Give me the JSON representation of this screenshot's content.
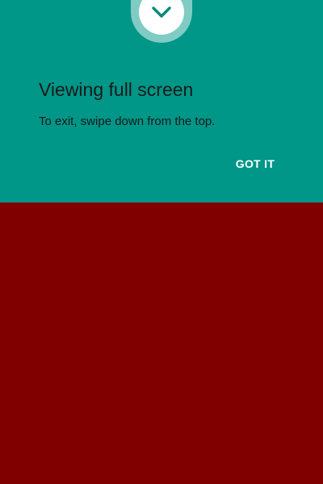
{
  "app": {
    "content_background": "#800000"
  },
  "immersive_dialog": {
    "background": "#009688",
    "icon": {
      "name": "chevron-down-icon",
      "ring_color": "#80cbc4",
      "fill_color": "#ffffff",
      "glyph_color": "#00897b"
    },
    "title": "Viewing full screen",
    "message": "To exit, swipe down from the top.",
    "text_color": "#1a1a1a",
    "button": {
      "label": "GOT IT",
      "color": "#ffffff"
    }
  }
}
